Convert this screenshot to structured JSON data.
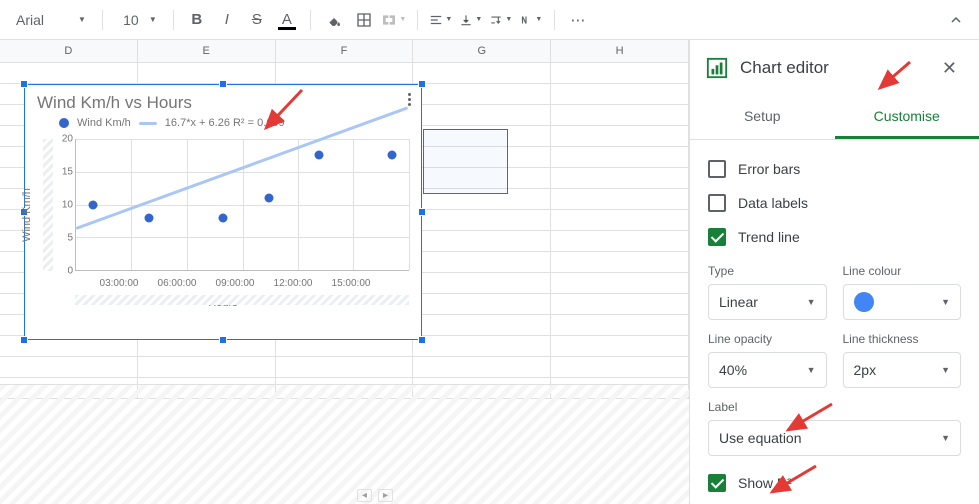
{
  "toolbar": {
    "font_name": "Arial",
    "font_size": "10"
  },
  "columns": [
    "D",
    "E",
    "F",
    "G",
    "H"
  ],
  "chart_data": {
    "type": "scatter",
    "title": "Wind Km/h vs Hours",
    "xlabel": "Hours",
    "ylabel": "Wind Km/h",
    "series_name": "Wind Km/h",
    "equation": "16.7*x + 6.26 R² = 0.699",
    "ylim": [
      0,
      20
    ],
    "yticks": [
      0,
      5,
      10,
      15,
      20
    ],
    "xticks": [
      "03:00:00",
      "06:00:00",
      "09:00:00",
      "12:00:00",
      "15:00:00"
    ],
    "points": [
      {
        "x": "02:00:00",
        "y": 10
      },
      {
        "x": "04:30:00",
        "y": 8
      },
      {
        "x": "08:00:00",
        "y": 8
      },
      {
        "x": "10:00:00",
        "y": 11
      },
      {
        "x": "12:30:00",
        "y": 18
      },
      {
        "x": "15:30:00",
        "y": 18
      }
    ],
    "trend": {
      "type": "Linear",
      "opacity": "40%",
      "thickness": "2px",
      "color": "#4285f4"
    }
  },
  "panel": {
    "title": "Chart editor",
    "tabs": {
      "setup": "Setup",
      "customise": "Customise"
    },
    "checks": {
      "error_bars": {
        "label": "Error bars",
        "checked": false
      },
      "data_labels": {
        "label": "Data labels",
        "checked": false
      },
      "trend_line": {
        "label": "Trend line",
        "checked": true
      },
      "show_r2": {
        "label": "Show R²",
        "checked": true
      }
    },
    "fields": {
      "type": {
        "label": "Type",
        "value": "Linear"
      },
      "line_colour": {
        "label": "Line colour"
      },
      "line_opacity": {
        "label": "Line opacity",
        "value": "40%"
      },
      "line_thickness": {
        "label": "Line thickness",
        "value": "2px"
      },
      "label": {
        "label": "Label",
        "value": "Use equation"
      }
    }
  }
}
